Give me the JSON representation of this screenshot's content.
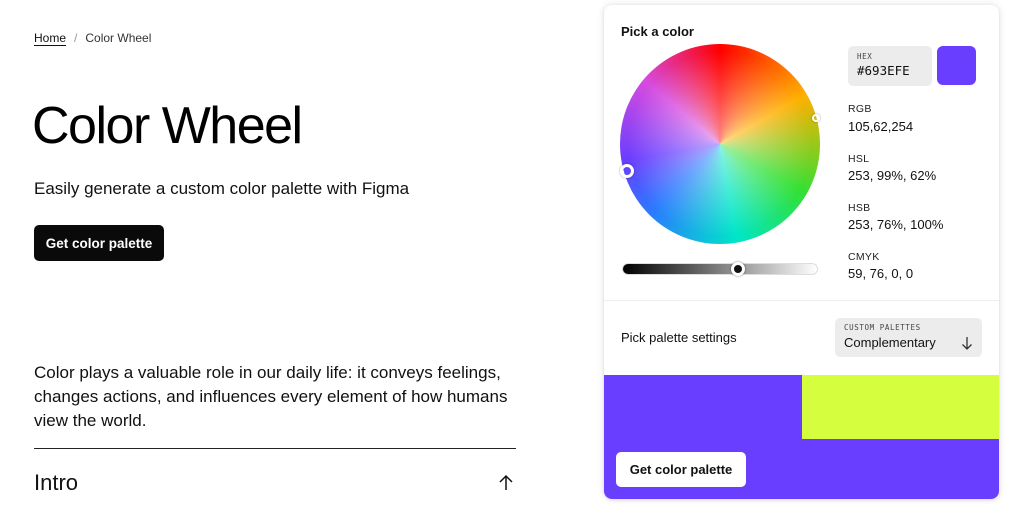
{
  "breadcrumb": {
    "home": "Home",
    "separator": "/",
    "current": "Color Wheel"
  },
  "hero": {
    "title": "Color Wheel",
    "subtitle": "Easily generate a custom color palette with Figma",
    "cta": "Get color palette"
  },
  "intro": {
    "paragraph": "Color plays a valuable role in our daily life: it conveys feelings, changes actions, and influences every element of how humans view the world.",
    "accordion_title": "Intro",
    "accordion_icon": "arrow-up-icon"
  },
  "picker": {
    "heading": "Pick a color",
    "hex_label": "HEX",
    "hex_value": "#693EFE",
    "swatch_color": "#693EFE",
    "rgb_label": "RGB",
    "rgb_value": "105,62,254",
    "hsl_label": "HSL",
    "hsl_value": "253, 99%, 62%",
    "hsb_label": "HSB",
    "hsb_value": "253, 76%, 100%",
    "cmyk_label": "CMYK",
    "cmyk_value": "59, 76, 0, 0",
    "brightness": 0.6
  },
  "palette_settings": {
    "label": "Pick palette settings",
    "select_label": "CUSTOM PALETTES",
    "select_value": "Complementary",
    "select_icon": "arrow-down-icon",
    "colors": {
      "primary": "#693EFE",
      "complement": "#D4FE3E"
    },
    "cta": "Get color palette"
  }
}
